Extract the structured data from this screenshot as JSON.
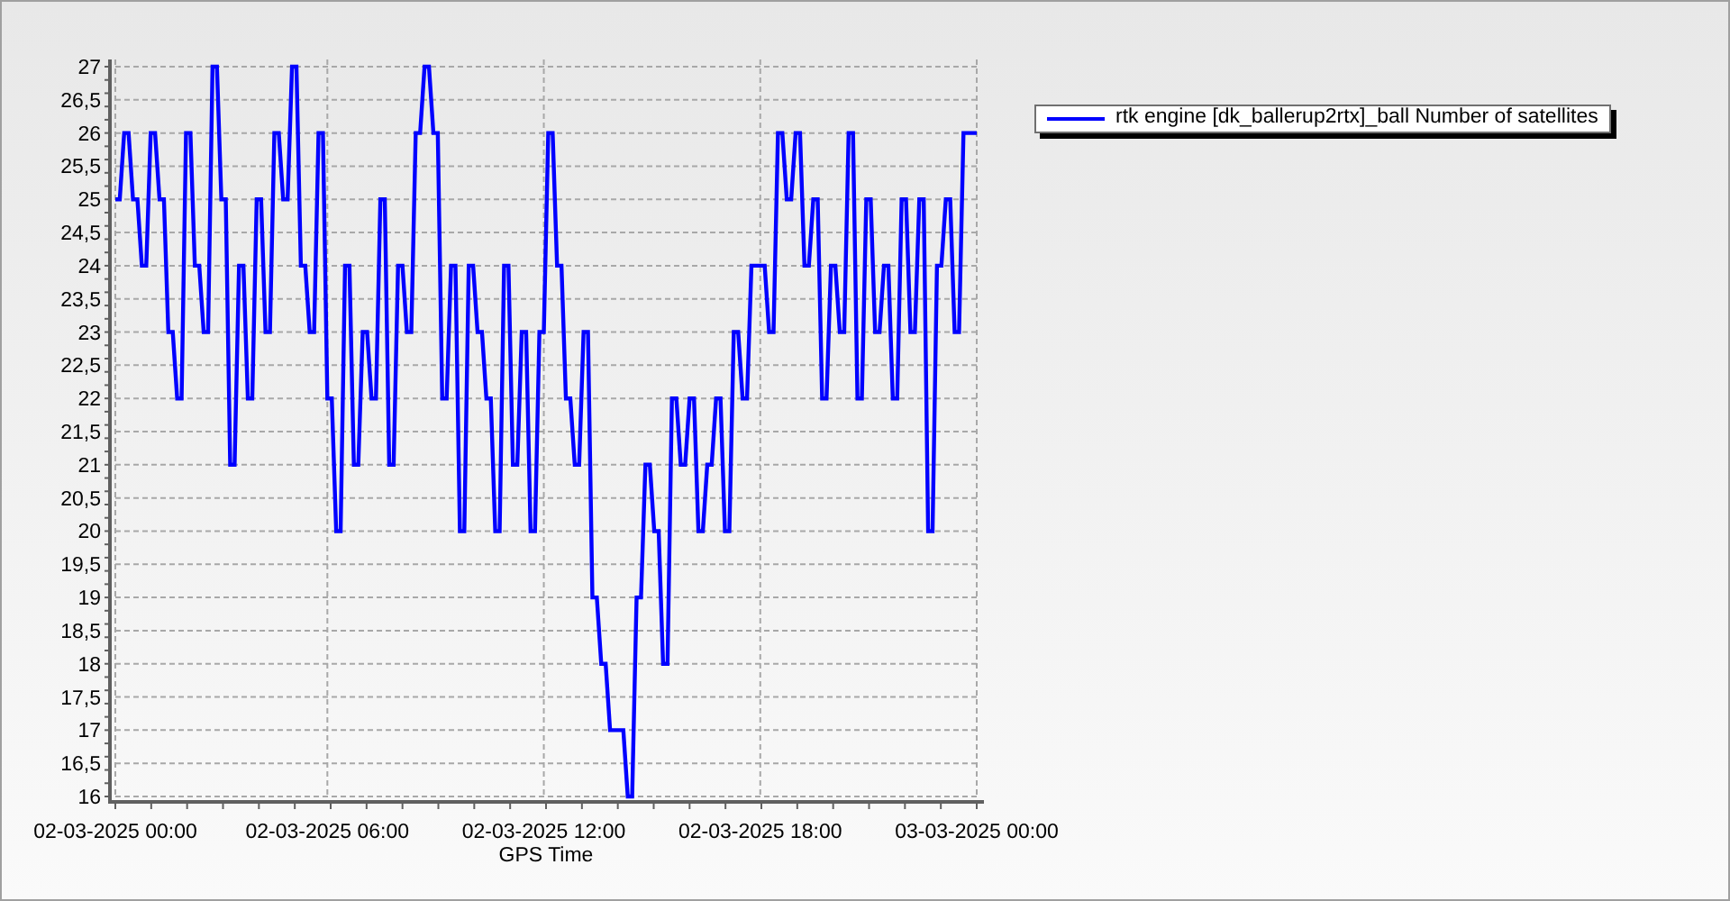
{
  "chart": {
    "chart_data": {
      "type": "line",
      "xlabel": "GPS Time",
      "grid": true,
      "categories": [
        "02-03-2025 00:00",
        null,
        null,
        null,
        null,
        null,
        null,
        null,
        null,
        null,
        null,
        null,
        null,
        null,
        null,
        null,
        null,
        null,
        null,
        null,
        null,
        null,
        null,
        null,
        null,
        null,
        null,
        null,
        null,
        null,
        null,
        null,
        null,
        null,
        null,
        null,
        null,
        null,
        null,
        null,
        null,
        null,
        null,
        null,
        null,
        null,
        null,
        null,
        "02-03-2025 06:00",
        null,
        null,
        null,
        null,
        null,
        null,
        null,
        null,
        null,
        null,
        null,
        null,
        null,
        null,
        null,
        null,
        null,
        null,
        null,
        null,
        null,
        null,
        null,
        null,
        null,
        null,
        null,
        null,
        null,
        null,
        null,
        null,
        null,
        null,
        null,
        null,
        null,
        null,
        null,
        null,
        null,
        null,
        null,
        null,
        null,
        null,
        null,
        null,
        "02-03-2025 12:00",
        null,
        null,
        null,
        null,
        null,
        null,
        null,
        null,
        null,
        null,
        null,
        null,
        null,
        null,
        null,
        null,
        null,
        null,
        null,
        null,
        null,
        null,
        null,
        null,
        null,
        null,
        null,
        null,
        null,
        null,
        null,
        null,
        null,
        null,
        null,
        null,
        null,
        null,
        null,
        null,
        null,
        null,
        null,
        null,
        null,
        null,
        null,
        null,
        "02-03-2025 18:00",
        null,
        null,
        null,
        null,
        null,
        null,
        null,
        null,
        null,
        null,
        null,
        null,
        null,
        null,
        null,
        null,
        null,
        null,
        null,
        null,
        null,
        null,
        null,
        null,
        null,
        null,
        null,
        null,
        null,
        null,
        null,
        null,
        null,
        null,
        null,
        null,
        null,
        null,
        null,
        null,
        null,
        null,
        null,
        null,
        null,
        null,
        null,
        null,
        "03-03-2025 00:00"
      ],
      "series": [
        {
          "name": "rtk engine [dk_ballerup2rtx]_ball Number of satellites",
          "color": "#0000ff",
          "values": [
            25,
            25,
            26,
            26,
            25,
            25,
            24,
            24,
            26,
            26,
            25,
            25,
            23,
            23,
            22,
            22,
            26,
            26,
            24,
            24,
            23,
            23,
            27,
            27,
            25,
            25,
            21,
            21,
            24,
            24,
            22,
            22,
            25,
            25,
            23,
            23,
            26,
            26,
            25,
            25,
            27,
            27,
            24,
            24,
            23,
            23,
            26,
            26,
            22,
            22,
            20,
            20,
            24,
            24,
            21,
            21,
            23,
            23,
            22,
            22,
            25,
            25,
            21,
            21,
            24,
            24,
            23,
            23,
            26,
            26,
            27,
            27,
            26,
            26,
            22,
            22,
            24,
            24,
            20,
            20,
            24,
            24,
            23,
            23,
            22,
            22,
            20,
            20,
            24,
            24,
            21,
            21,
            23,
            23,
            20,
            20,
            23,
            23,
            26,
            26,
            24,
            24,
            22,
            22,
            21,
            21,
            23,
            23,
            19,
            19,
            18,
            18,
            17,
            17,
            17,
            17,
            16,
            16,
            19,
            19,
            21,
            21,
            20,
            20,
            18,
            18,
            22,
            22,
            21,
            21,
            22,
            22,
            20,
            20,
            21,
            21,
            22,
            22,
            20,
            20,
            23,
            23,
            22,
            22,
            24,
            24,
            24,
            24,
            23,
            23,
            26,
            26,
            25,
            25,
            26,
            26,
            24,
            24,
            25,
            25,
            22,
            22,
            24,
            24,
            23,
            23,
            26,
            26,
            22,
            22,
            25,
            25,
            23,
            23,
            24,
            24,
            22,
            22,
            25,
            25,
            23,
            23,
            25,
            25,
            20,
            20,
            24,
            24,
            25,
            25,
            23,
            23,
            26,
            26,
            26,
            26
          ]
        }
      ],
      "ylim": [
        16,
        27
      ],
      "yticks": [
        {
          "value": 16,
          "label": "16"
        },
        {
          "value": 16.5,
          "label": "16,5"
        },
        {
          "value": 17,
          "label": "17"
        },
        {
          "value": 17.5,
          "label": "17,5"
        },
        {
          "value": 18,
          "label": "18"
        },
        {
          "value": 18.5,
          "label": "18,5"
        },
        {
          "value": 19,
          "label": "19"
        },
        {
          "value": 19.5,
          "label": "19,5"
        },
        {
          "value": 20,
          "label": "20"
        },
        {
          "value": 20.5,
          "label": "20,5"
        },
        {
          "value": 21,
          "label": "21"
        },
        {
          "value": 21.5,
          "label": "21,5"
        },
        {
          "value": 22,
          "label": "22"
        },
        {
          "value": 22.5,
          "label": "22,5"
        },
        {
          "value": 23,
          "label": "23"
        },
        {
          "value": 23.5,
          "label": "23,5"
        },
        {
          "value": 24,
          "label": "24"
        },
        {
          "value": 24.5,
          "label": "24,5"
        },
        {
          "value": 25,
          "label": "25"
        },
        {
          "value": 25.5,
          "label": "25,5"
        },
        {
          "value": 26,
          "label": "26"
        },
        {
          "value": 26.5,
          "label": "26,5"
        },
        {
          "value": 27,
          "label": "27"
        }
      ]
    }
  }
}
